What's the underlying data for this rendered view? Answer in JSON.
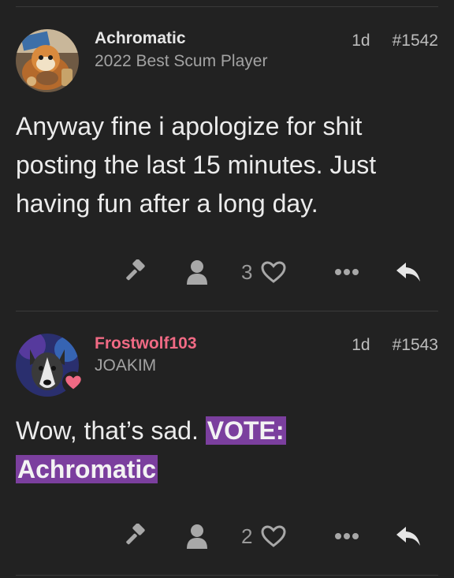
{
  "posts": [
    {
      "username": "Achromatic",
      "user_title": "2022 Best Scum Player",
      "username_color": "#e6e6e6",
      "age": "1d",
      "post_number": "#1542",
      "body": "Anyway fine i apologize for shit posting the last 15 minutes. Just having fun after a long day.",
      "like_count": "3",
      "icons": [
        "gavel-icon",
        "user-icon",
        "heart-icon",
        "more-icon",
        "reply-icon"
      ]
    },
    {
      "username": "Frostwolf103",
      "user_title": "JOAKIM",
      "username_color": "#f06a84",
      "age": "1d",
      "post_number": "#1543",
      "body_plain": "Wow, that’s sad.",
      "body_highlight_1": "VOTE:",
      "body_highlight_2": "Achromatic",
      "highlight_color": "#7b3f9e",
      "like_count": "2",
      "icons": [
        "gavel-icon",
        "user-icon",
        "heart-icon",
        "more-icon",
        "reply-icon"
      ]
    }
  ]
}
